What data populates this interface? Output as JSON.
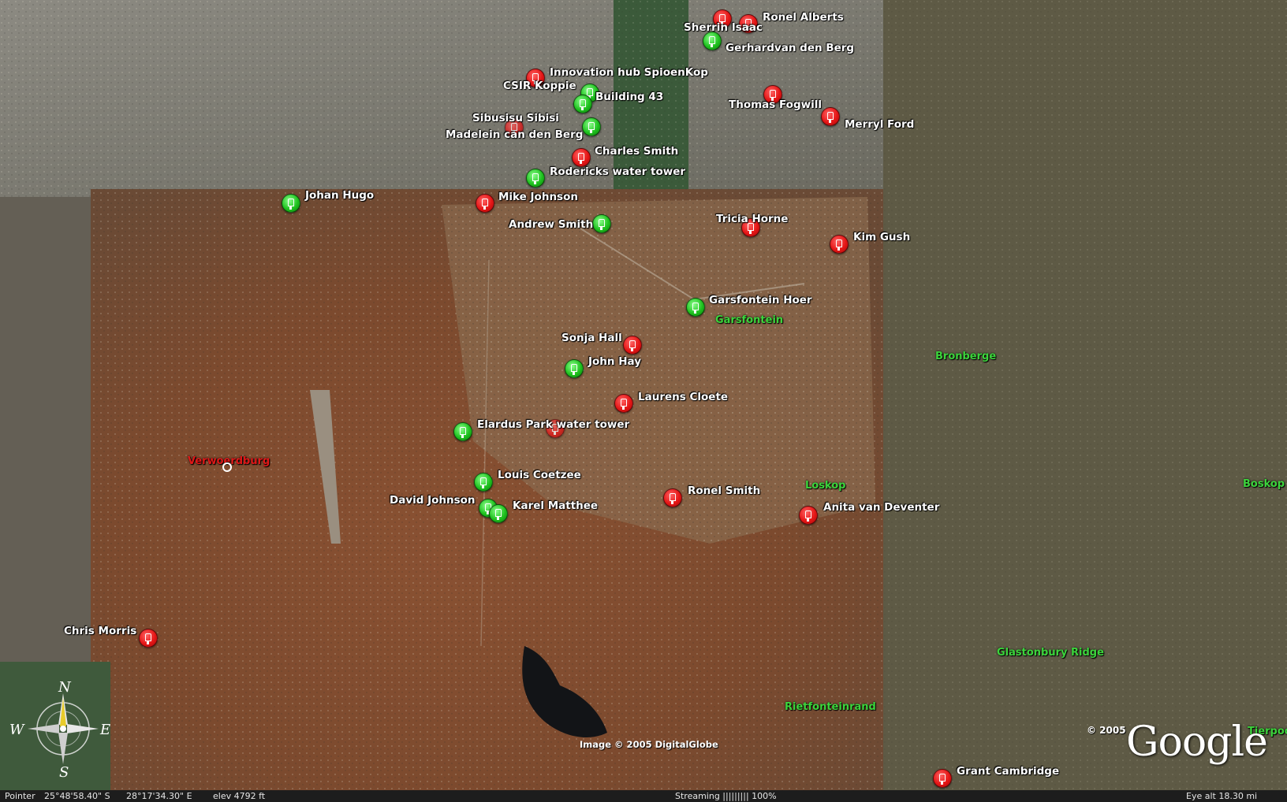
{
  "markers": [
    {
      "label": "Ronel Alberts",
      "color": "red"
    },
    {
      "label": "Sherrin Isaac",
      "color": "red"
    },
    {
      "label": "Gerhardvan den Berg",
      "color": "green"
    },
    {
      "label": "Innovation hub SpioenKop",
      "color": "red"
    },
    {
      "label": "CSIR Koppie",
      "color": "green"
    },
    {
      "label": "Building 43",
      "color": "green"
    },
    {
      "label": "Thomas Fogwill",
      "color": "red"
    },
    {
      "label": "Merryl Ford",
      "color": "red"
    },
    {
      "label": "Sibusisu Sibisi",
      "color": "red"
    },
    {
      "label": "Madelein can den Berg",
      "color": "green"
    },
    {
      "label": "Charles Smith",
      "color": "red"
    },
    {
      "label": "Rodericks water tower",
      "color": "green"
    },
    {
      "label": "Johan Hugo",
      "color": "green"
    },
    {
      "label": "Mike Johnson",
      "color": "red"
    },
    {
      "label": "Andrew Smith",
      "color": "green"
    },
    {
      "label": "Tricia Horne",
      "color": "red"
    },
    {
      "label": "Kim Gush",
      "color": "red"
    },
    {
      "label": "Garsfontein Hoer",
      "color": "green"
    },
    {
      "label": "Sonja Hall",
      "color": "red"
    },
    {
      "label": "John Hay",
      "color": "green"
    },
    {
      "label": "Laurens Cloete",
      "color": "red"
    },
    {
      "label": "Elardus Park water tower",
      "color": "green"
    },
    {
      "label": "Louis Coetzee",
      "color": "green"
    },
    {
      "label": "David Johnson",
      "color": "green"
    },
    {
      "label": "Karel Matthee",
      "color": "green"
    },
    {
      "label": "Ronel Smith",
      "color": "red"
    },
    {
      "label": "Anita van Deventer",
      "color": "red"
    },
    {
      "label": "Chris Morris",
      "color": "red"
    },
    {
      "label": "Grant Cambridge",
      "color": "red"
    }
  ],
  "places": [
    {
      "label": "Garsfontein",
      "color": "green"
    },
    {
      "label": "Bronberge",
      "color": "green"
    },
    {
      "label": "Verwoerdburg",
      "color": "red"
    },
    {
      "label": "Loskop",
      "color": "green"
    },
    {
      "label": "Boskop",
      "color": "green"
    },
    {
      "label": "Glastonbury Ridge",
      "color": "green"
    },
    {
      "label": "Rietfonteinrand",
      "color": "green"
    },
    {
      "label": "Tierpoo",
      "color": "green"
    }
  ],
  "imagery_credit": "Image © 2005 DigitalGlobe",
  "copyright": "© 2005",
  "brand": "Google",
  "compass": {
    "n": "N",
    "s": "S",
    "e": "E",
    "w": "W"
  },
  "status": {
    "pointer_label": "Pointer",
    "lat": "25°48'58.40\" S",
    "lon": "28°17'34.30\" E",
    "elev": "elev 4792 ft",
    "streaming": "Streaming ||||||||| 100%",
    "eye_alt": "Eye alt 18.30 mi"
  }
}
